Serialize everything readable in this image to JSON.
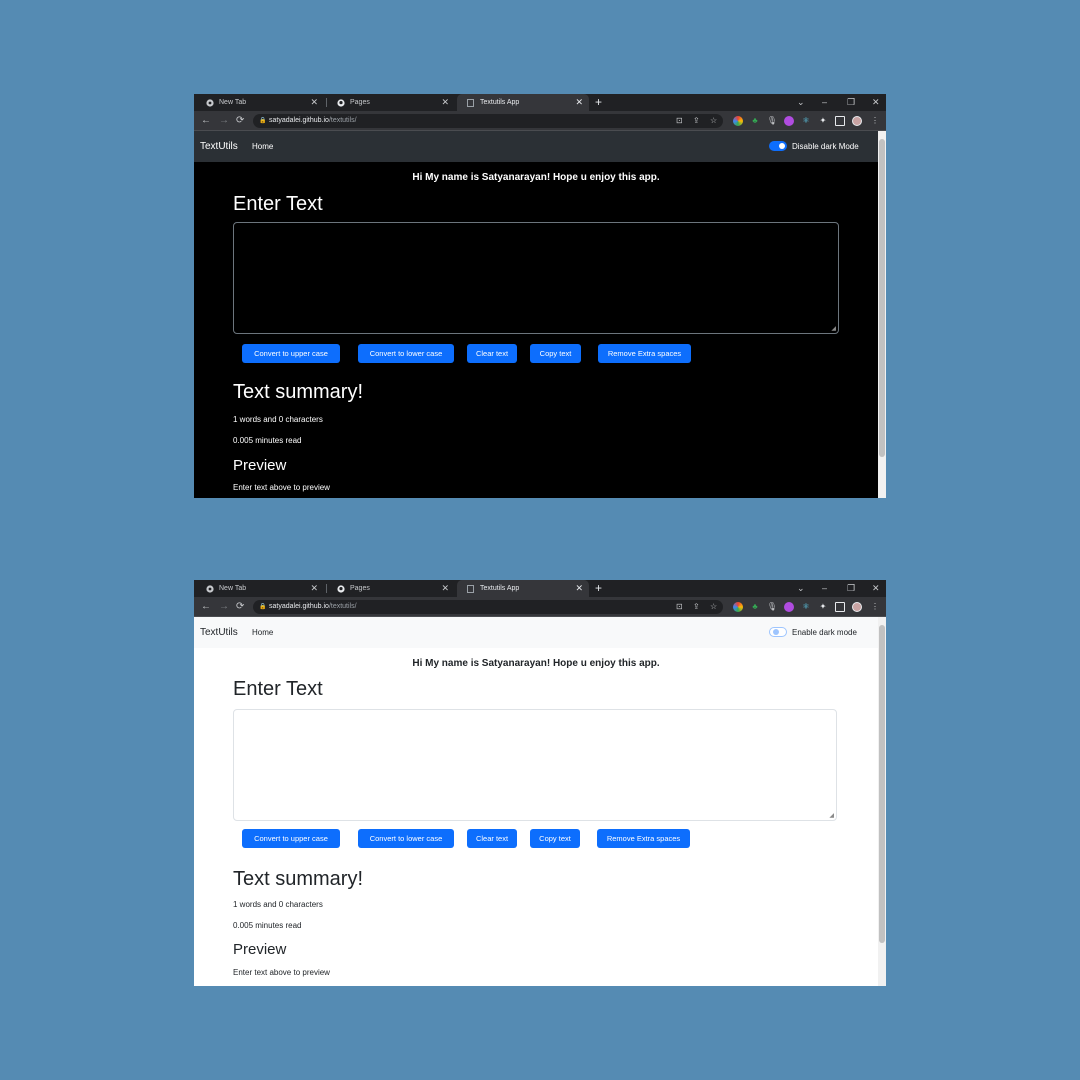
{
  "browser": {
    "tabs": [
      {
        "title": "New Tab",
        "icon": "chrome-icon"
      },
      {
        "title": "Pages",
        "icon": "github-icon"
      },
      {
        "title": "Textutils App",
        "icon": "page-icon"
      }
    ],
    "new_tab_symbol": "+",
    "close_symbol": "✕",
    "url_host": "satyadalei.github.io",
    "url_path": "/textutils/",
    "win_chevron": "⌄",
    "win_min": "–",
    "win_max": "❐",
    "win_close": "✕"
  },
  "app": {
    "brand": "TextUtils",
    "nav_home": "Home",
    "greeting": "Hi My name is Satyanarayan! Hope u enjoy this app.",
    "heading_enter": "Enter Text",
    "buttons": {
      "upper": "Convert to upper case",
      "lower": "Convert to lower case",
      "clear": "Clear text",
      "copy": "Copy text",
      "extra": "Remove Extra spaces"
    },
    "heading_summary": "Text summary!",
    "words_line": "1 words and 0 characters",
    "read_line": "0.005 minutes read",
    "heading_preview": "Preview",
    "preview_text": "Enter text above to preview"
  },
  "dark_view": {
    "toggle_label": "Disable dark Mode",
    "toggle_on": true,
    "page_bg": "#000000",
    "navbar_bg": "#2b3035"
  },
  "light_view": {
    "toggle_label": "Enable dark mode",
    "toggle_on": false,
    "page_bg": "#ffffff",
    "navbar_bg": "#f8f9fa"
  },
  "colors": {
    "backdrop": "#558bb3",
    "button": "#0d6efd"
  }
}
